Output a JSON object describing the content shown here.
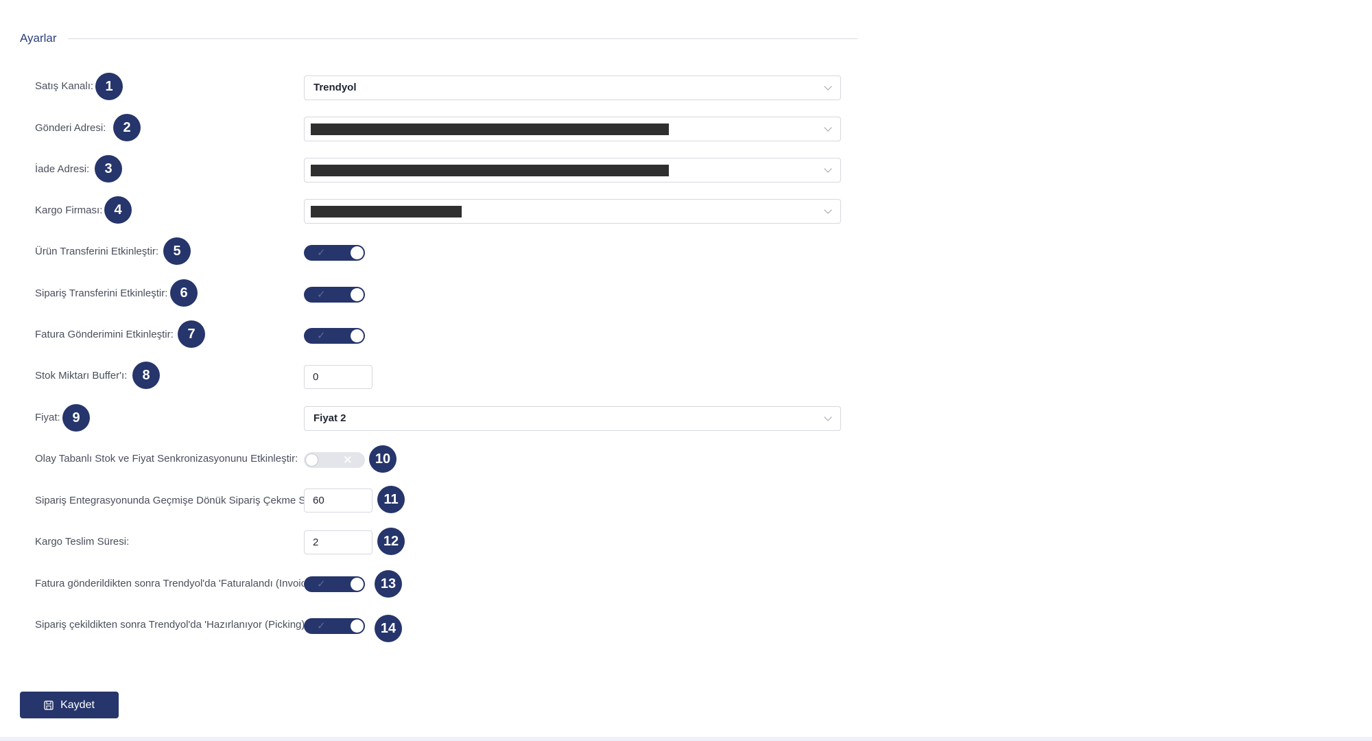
{
  "section": {
    "title": "Ayarlar"
  },
  "fields": {
    "sales_channel": {
      "label": "Satış Kanalı:",
      "value": "Trendyol",
      "badge": "1"
    },
    "shipping_address": {
      "label": "Gönderi Adresi:",
      "badge": "2"
    },
    "return_address": {
      "label": "İade Adresi:",
      "badge": "3"
    },
    "cargo_company": {
      "label": "Kargo Firması:",
      "badge": "4"
    },
    "product_transfer": {
      "label": "Ürün Transferini Etkinleştir:",
      "enabled": true,
      "badge": "5"
    },
    "order_transfer": {
      "label": "Sipariş Transferini Etkinleştir:",
      "enabled": true,
      "badge": "6"
    },
    "invoice_sending": {
      "label": "Fatura Gönderimini Etkinleştir:",
      "enabled": true,
      "badge": "7"
    },
    "stock_buffer": {
      "label": "Stok Miktarı Buffer'ı:",
      "value": "0",
      "badge": "8"
    },
    "price": {
      "label": "Fiyat:",
      "value": "Fiyat 2",
      "badge": "9"
    },
    "event_sync": {
      "label": "Olay Tabanlı Stok ve Fiyat Senkronizasyonunu Etkinleştir:",
      "enabled": false,
      "badge": "10"
    },
    "order_backfill": {
      "label": "Sipariş Entegrasyonunda Geçmişe Dönük Sipariş Çekme Süresi:",
      "value": "60",
      "badge": "11"
    },
    "cargo_delivery": {
      "label": "Kargo Teslim Süresi:",
      "value": "2",
      "badge": "12"
    },
    "invoiced_status": {
      "label": "Fatura gönderildikten sonra Trendyol'da 'Faturalandı (Invoiced)' statüsüne çek:",
      "enabled": true,
      "badge": "13"
    },
    "picking_status": {
      "label": "Sipariş çekildikten sonra Trendyol'da 'Hazırlanıyor (Picking)' statüsüne çek:",
      "enabled": true,
      "badge": "14"
    }
  },
  "actions": {
    "save_label": "Kaydet"
  },
  "icons": {
    "toggle_on": "check-icon",
    "toggle_off": "x-icon",
    "select": "chevron-down-icon",
    "save": "floppy-disk-icon"
  },
  "colors": {
    "primary": "#26356b",
    "border": "#d5d8de",
    "label": "#4a4f5c",
    "title": "#2b3f7a"
  }
}
